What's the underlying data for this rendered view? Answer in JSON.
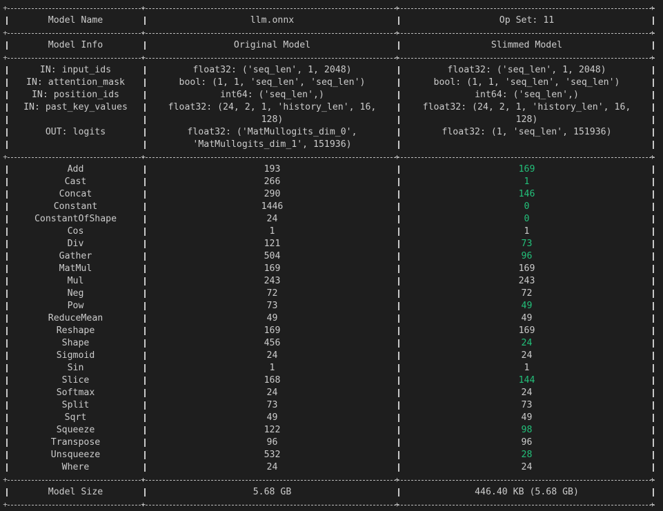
{
  "header": {
    "col0": "Model Name",
    "col1": "llm.onnx",
    "col2": "Op Set: 11"
  },
  "info_header": {
    "col0": "Model Info",
    "col1": "Original Model",
    "col2": "Slimmed Model"
  },
  "io_rows": [
    {
      "name": "IN: input_ids",
      "original": [
        "float32: ('seq_len', 1, 2048)"
      ],
      "slimmed": [
        "float32: ('seq_len', 1, 2048)"
      ]
    },
    {
      "name": "IN: attention_mask",
      "original": [
        "bool: (1, 1, 'seq_len', 'seq_len')"
      ],
      "slimmed": [
        "bool: (1, 1, 'seq_len', 'seq_len')"
      ]
    },
    {
      "name": "IN: position_ids",
      "original": [
        "int64: ('seq_len',)"
      ],
      "slimmed": [
        "int64: ('seq_len',)"
      ]
    },
    {
      "name": "IN: past_key_values",
      "original": [
        "float32: (24, 2, 1, 'history_len', 16,",
        "128)"
      ],
      "slimmed": [
        "float32: (24, 2, 1, 'history_len', 16,",
        "128)"
      ]
    },
    {
      "name": "OUT: logits",
      "original": [
        "float32: ('MatMullogits_dim_0',",
        "'MatMullogits_dim_1', 151936)"
      ],
      "slimmed": [
        "float32: (1, 'seq_len', 151936)"
      ]
    }
  ],
  "op_rows": [
    {
      "op": "Add",
      "original": "193",
      "slimmed": "169",
      "changed": true
    },
    {
      "op": "Cast",
      "original": "266",
      "slimmed": "1",
      "changed": true
    },
    {
      "op": "Concat",
      "original": "290",
      "slimmed": "146",
      "changed": true
    },
    {
      "op": "Constant",
      "original": "1446",
      "slimmed": "0",
      "changed": true
    },
    {
      "op": "ConstantOfShape",
      "original": "24",
      "slimmed": "0",
      "changed": true
    },
    {
      "op": "Cos",
      "original": "1",
      "slimmed": "1",
      "changed": false
    },
    {
      "op": "Div",
      "original": "121",
      "slimmed": "73",
      "changed": true
    },
    {
      "op": "Gather",
      "original": "504",
      "slimmed": "96",
      "changed": true
    },
    {
      "op": "MatMul",
      "original": "169",
      "slimmed": "169",
      "changed": false
    },
    {
      "op": "Mul",
      "original": "243",
      "slimmed": "243",
      "changed": false
    },
    {
      "op": "Neg",
      "original": "72",
      "slimmed": "72",
      "changed": false
    },
    {
      "op": "Pow",
      "original": "73",
      "slimmed": "49",
      "changed": true
    },
    {
      "op": "ReduceMean",
      "original": "49",
      "slimmed": "49",
      "changed": false
    },
    {
      "op": "Reshape",
      "original": "169",
      "slimmed": "169",
      "changed": false
    },
    {
      "op": "Shape",
      "original": "456",
      "slimmed": "24",
      "changed": true
    },
    {
      "op": "Sigmoid",
      "original": "24",
      "slimmed": "24",
      "changed": false
    },
    {
      "op": "Sin",
      "original": "1",
      "slimmed": "1",
      "changed": false
    },
    {
      "op": "Slice",
      "original": "168",
      "slimmed": "144",
      "changed": true
    },
    {
      "op": "Softmax",
      "original": "24",
      "slimmed": "24",
      "changed": false
    },
    {
      "op": "Split",
      "original": "73",
      "slimmed": "73",
      "changed": false
    },
    {
      "op": "Sqrt",
      "original": "49",
      "slimmed": "49",
      "changed": false
    },
    {
      "op": "Squeeze",
      "original": "122",
      "slimmed": "98",
      "changed": true
    },
    {
      "op": "Transpose",
      "original": "96",
      "slimmed": "96",
      "changed": false
    },
    {
      "op": "Unsqueeze",
      "original": "532",
      "slimmed": "28",
      "changed": true
    },
    {
      "op": "Where",
      "original": "24",
      "slimmed": "24",
      "changed": false
    }
  ],
  "size_row": {
    "col0": "Model Size",
    "col1": "5.68 GB",
    "col2": "446.40 KB (5.68 GB)"
  },
  "colors": {
    "background": "#1e1e1e",
    "text": "#cccccc",
    "changed_value": "#23c07a"
  }
}
